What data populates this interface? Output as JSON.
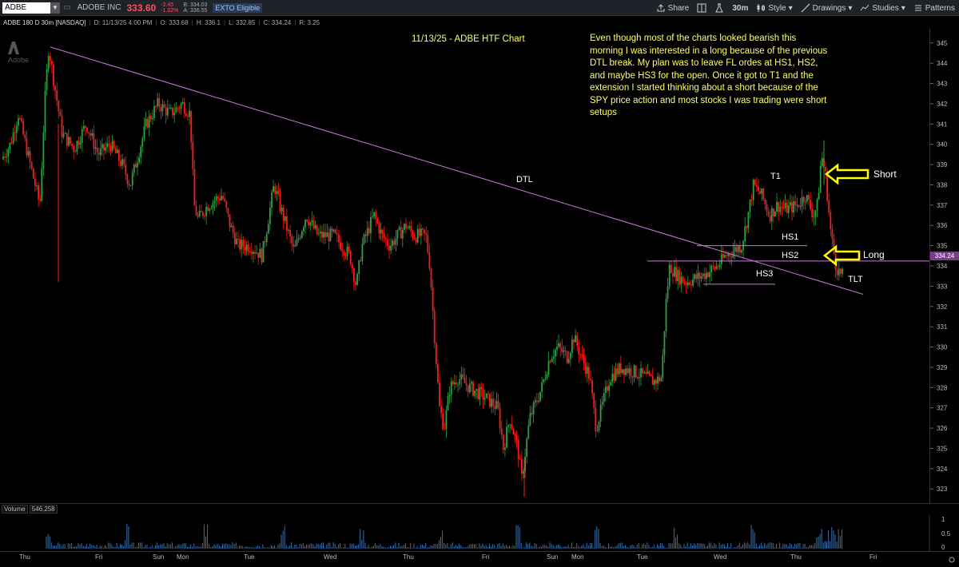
{
  "toolbar": {
    "symbol": "ADBE",
    "company": "ADOBE INC",
    "price": "333.60",
    "change": "-3.45",
    "change_pct": "-1.02%",
    "bid": "B: 334.03",
    "ask": "A: 336.55",
    "exto": "EXTO Eligible",
    "share": "Share",
    "interval": "30m",
    "style": "Style",
    "drawings": "Drawings",
    "studies": "Studies",
    "patterns": "Patterns"
  },
  "infobar": {
    "title": "ADBE 180 D 30m [NASDAQ]",
    "date": "D: 11/13/25 4:00 PM",
    "open": "O: 333.68",
    "high": "H: 336.1",
    "low": "L: 332.85",
    "close": "C: 334.24",
    "range": "R: 3.25"
  },
  "watermark": "Adobe",
  "chart_title": "11/13/25 - ADBE HTF Chart",
  "annotation": "Even though most of the charts looked bearish this morning I was interested in a long because of the previous DTL break. My plan was to leave FL ordes at HS1, HS2, and maybe HS3 for the open. Once it got to T1 and the extension I started thinking about a short because of the SPY price action and most stocks I was trading were short setups",
  "labels": {
    "dtl": "DTL",
    "t1": "T1",
    "hs1": "HS1",
    "hs2": "HS2",
    "hs3": "HS3",
    "tlt": "TLT",
    "short": "Short",
    "long": "Long"
  },
  "price_tag": "334.24",
  "volume": {
    "label": "Volume",
    "value": "546,258"
  },
  "colors": {
    "up": "#2ea043",
    "down": "#ff1a1a",
    "trend": "#cc77dd",
    "annotation": "#ffff66",
    "price_tag": "#7a3d8a"
  },
  "chart_data": {
    "type": "candlestick",
    "y_ticks": [
      323,
      324,
      325,
      326,
      327,
      328,
      329,
      330,
      331,
      332,
      333,
      334,
      335,
      336,
      337,
      338,
      339,
      340,
      341,
      342,
      343,
      344,
      345
    ],
    "ylim": [
      322.3,
      345.7
    ],
    "volume_ticks": [
      "1",
      "0.5",
      "0"
    ],
    "x_ticks": [
      "Thu",
      "Fri",
      "Sun",
      "Mon",
      "Tue",
      "Wed",
      "Thu",
      "Fri",
      "Sun",
      "Mon",
      "Tue",
      "Wed",
      "Thu",
      "Fri"
    ],
    "levels": {
      "hs1": 335.0,
      "hs2": 334.24,
      "hs3": 333.1
    },
    "trendline": [
      [
        63,
        344.8
      ],
      [
        1080,
        332.6
      ]
    ],
    "price_path": [
      [
        0,
        339
      ],
      [
        15,
        340
      ],
      [
        25,
        341.5
      ],
      [
        40,
        339
      ],
      [
        52,
        337
      ],
      [
        58,
        342
      ],
      [
        63,
        344.8
      ],
      [
        70,
        343
      ],
      [
        80,
        340.5
      ],
      [
        95,
        339.8
      ],
      [
        110,
        341
      ],
      [
        125,
        339.5
      ],
      [
        140,
        340
      ],
      [
        155,
        339
      ],
      [
        165,
        338
      ],
      [
        175,
        339.5
      ],
      [
        185,
        341
      ],
      [
        200,
        342
      ],
      [
        215,
        341.5
      ],
      [
        230,
        342
      ],
      [
        240,
        341.5
      ],
      [
        245,
        337
      ],
      [
        250,
        336.3
      ],
      [
        262,
        337
      ],
      [
        280,
        337.5
      ],
      [
        290,
        336
      ],
      [
        300,
        335
      ],
      [
        315,
        335
      ],
      [
        330,
        334.5
      ],
      [
        345,
        338
      ],
      [
        352,
        337
      ],
      [
        360,
        336
      ],
      [
        370,
        334.7
      ],
      [
        385,
        336.5
      ],
      [
        400,
        335.5
      ],
      [
        420,
        335.5
      ],
      [
        440,
        334.5
      ],
      [
        448,
        333
      ],
      [
        455,
        335
      ],
      [
        470,
        336.5
      ],
      [
        480,
        335.5
      ],
      [
        490,
        335
      ],
      [
        500,
        335.5
      ],
      [
        510,
        336
      ],
      [
        520,
        335.5
      ],
      [
        535,
        335.5
      ],
      [
        540,
        334
      ],
      [
        545,
        331
      ],
      [
        552,
        327
      ],
      [
        558,
        326
      ],
      [
        565,
        328
      ],
      [
        575,
        328.5
      ],
      [
        590,
        328
      ],
      [
        610,
        327.5
      ],
      [
        625,
        327
      ],
      [
        632,
        325
      ],
      [
        640,
        326.5
      ],
      [
        650,
        325
      ],
      [
        655,
        323.5
      ],
      [
        665,
        326.5
      ],
      [
        680,
        328
      ],
      [
        690,
        329.5
      ],
      [
        700,
        330
      ],
      [
        712,
        329.5
      ],
      [
        720,
        330.5
      ],
      [
        730,
        329.5
      ],
      [
        740,
        328.5
      ],
      [
        748,
        326
      ],
      [
        755,
        327
      ],
      [
        765,
        328.5
      ],
      [
        780,
        329
      ],
      [
        800,
        328.7
      ],
      [
        820,
        328.3
      ],
      [
        830,
        328.5
      ],
      [
        835,
        332
      ],
      [
        840,
        334
      ],
      [
        850,
        333.5
      ],
      [
        860,
        333.2
      ],
      [
        880,
        333.5
      ],
      [
        900,
        334
      ],
      [
        910,
        334.5
      ],
      [
        930,
        335
      ],
      [
        938,
        336.5
      ],
      [
        945,
        338
      ],
      [
        955,
        337.5
      ],
      [
        965,
        336.5
      ],
      [
        975,
        337
      ],
      [
        985,
        336.8
      ],
      [
        1000,
        337
      ],
      [
        1010,
        337.5
      ],
      [
        1020,
        336.5
      ],
      [
        1025,
        337
      ],
      [
        1030,
        339.5
      ],
      [
        1035,
        338.5
      ],
      [
        1042,
        335.5
      ],
      [
        1048,
        334
      ],
      [
        1055,
        333.5
      ]
    ]
  }
}
